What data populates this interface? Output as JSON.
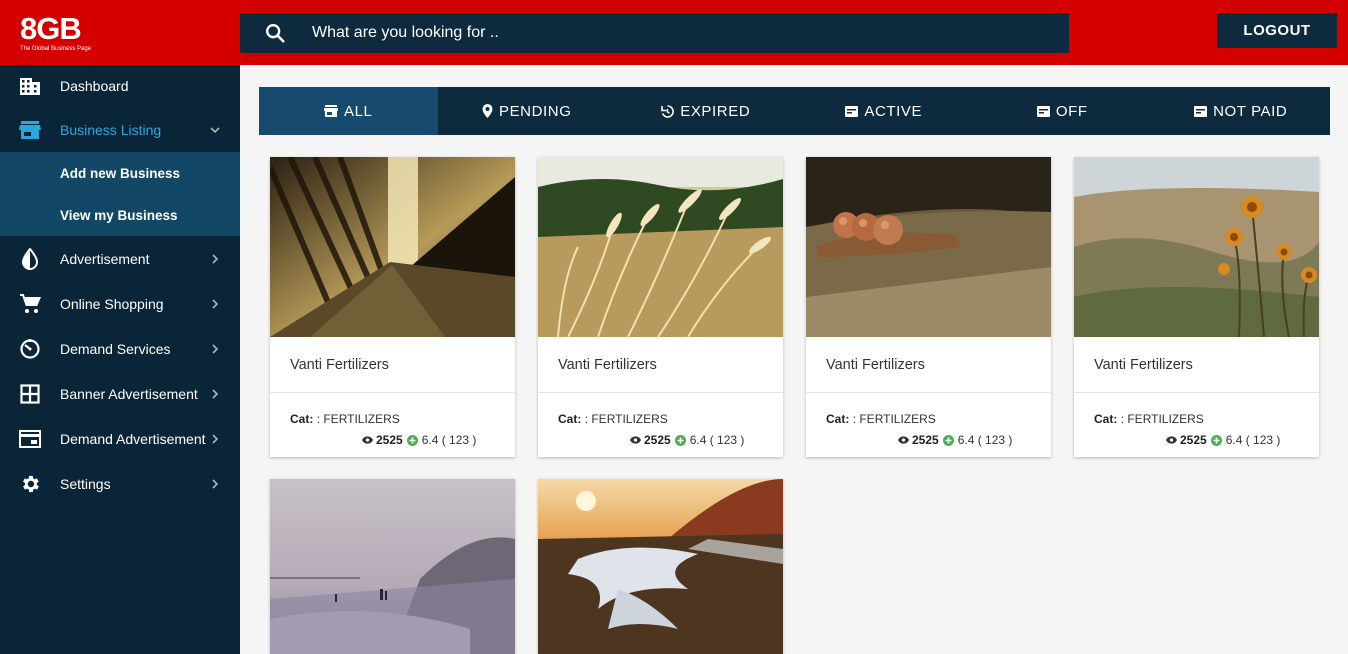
{
  "header": {
    "logo_main": "8GB",
    "logo_sub": "The Global Business Page",
    "search_placeholder": "What are you looking for ..",
    "logout_label": "LOGOUT"
  },
  "sidebar": {
    "items": [
      {
        "label": "Dashboard",
        "icon": "building-icon"
      },
      {
        "label": "Business Listing",
        "icon": "store-icon",
        "active": true,
        "subitems": [
          {
            "label": "Add new Business"
          },
          {
            "label": "View my Business"
          }
        ]
      },
      {
        "label": "Advertisement",
        "icon": "contrast-drop-icon"
      },
      {
        "label": "Online Shopping",
        "icon": "cart-icon"
      },
      {
        "label": "Demand Services",
        "icon": "timer-icon"
      },
      {
        "label": "Banner Advertisement",
        "icon": "grid-icon"
      },
      {
        "label": "Demand Advertisement",
        "icon": "card-icon"
      },
      {
        "label": "Settings",
        "icon": "gear-icon"
      }
    ]
  },
  "tabs": [
    {
      "label": "ALL",
      "icon": "store-icon",
      "selected": true
    },
    {
      "label": "PENDING",
      "icon": "pin-icon"
    },
    {
      "label": "EXPIRED",
      "icon": "history-icon"
    },
    {
      "label": "ACTIVE",
      "icon": "card-icon"
    },
    {
      "label": "OFF",
      "icon": "card-icon"
    },
    {
      "label": "NOT PAID",
      "icon": "card-icon"
    }
  ],
  "cards": [
    {
      "title": "Vanti Fertilizers",
      "cat_label": "Cat:",
      "cat_value": ": FERTILIZERS",
      "views": "2525",
      "rating": "6.4 ( 123 )",
      "image": "corridor"
    },
    {
      "title": "Vanti Fertilizers",
      "cat_label": "Cat:",
      "cat_value": ": FERTILIZERS",
      "views": "2525",
      "rating": "6.4 ( 123 )",
      "image": "wheat"
    },
    {
      "title": "Vanti Fertilizers",
      "cat_label": "Cat:",
      "cat_value": ": FERTILIZERS",
      "views": "2525",
      "rating": "6.4 ( 123 )",
      "image": "seeds"
    },
    {
      "title": "Vanti Fertilizers",
      "cat_label": "Cat:",
      "cat_value": ": FERTILIZERS",
      "views": "2525",
      "rating": "6.4 ( 123 )",
      "image": "thistle"
    },
    {
      "image": "beach"
    },
    {
      "image": "road"
    }
  ],
  "colors": {
    "header_red": "#d40000",
    "navy": "#0d2a3e",
    "sidebar": "#0b2538",
    "accent_blue": "#29a8e0",
    "rating_green": "#4caf50"
  }
}
